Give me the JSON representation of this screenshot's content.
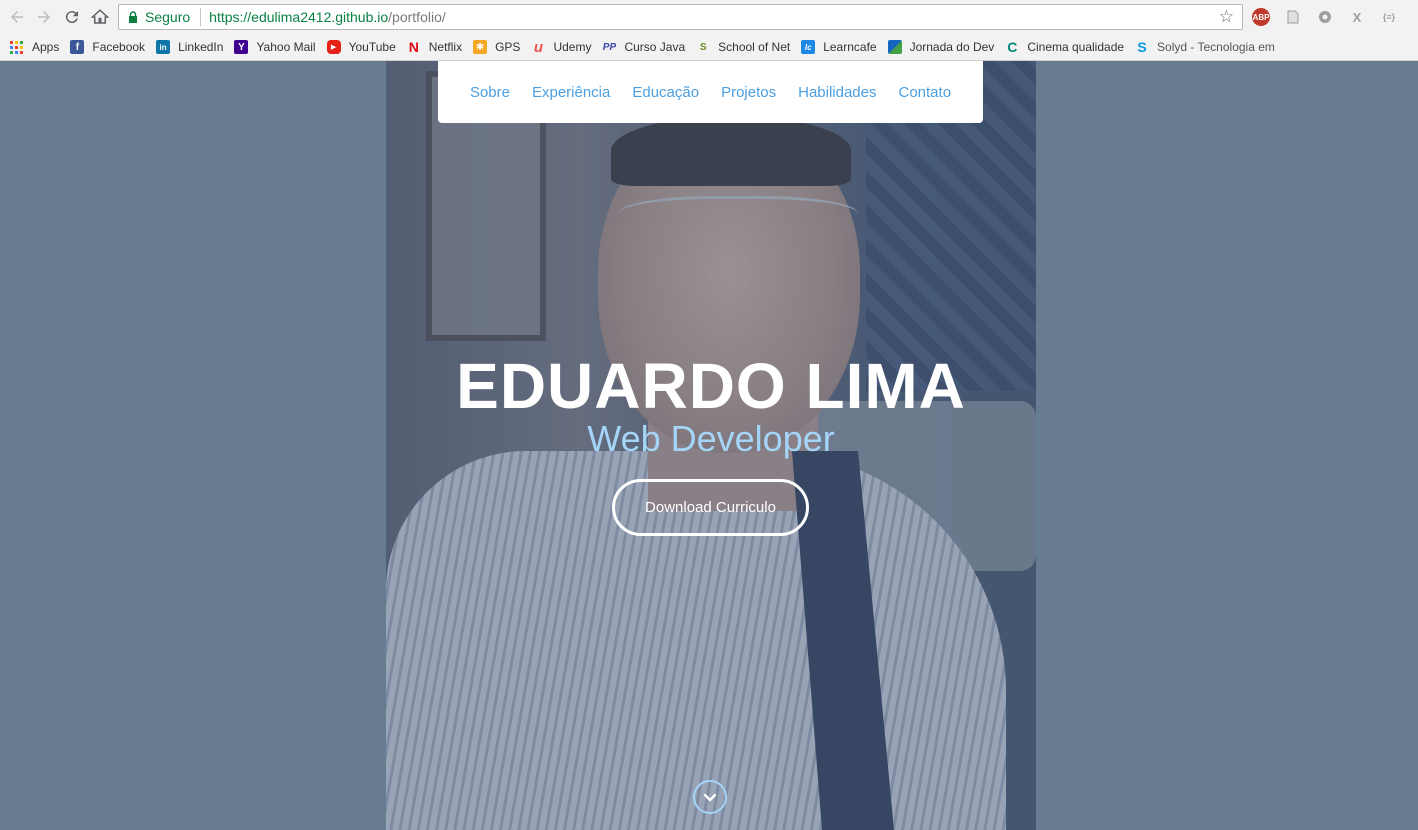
{
  "browser": {
    "secure_label": "Seguro",
    "url_host": "https://edulima2412.github.io",
    "url_path": "/portfolio/",
    "extensions": [
      {
        "name": "adblock-icon",
        "label": "ABP",
        "color": "#c0392b"
      },
      {
        "name": "pdf-extension-icon",
        "label": "",
        "color": "#9e9e9e"
      },
      {
        "name": "settings-extension-icon",
        "label": "",
        "color": "#757575"
      },
      {
        "name": "x-extension-icon",
        "label": "X",
        "color": "#9e9e9e"
      },
      {
        "name": "json-extension-icon",
        "label": "{≡}",
        "color": "#9e9e9e"
      }
    ]
  },
  "bookmarks": [
    {
      "label": "Apps",
      "icon": "apps-grid-icon"
    },
    {
      "label": "Facebook",
      "icon": "facebook-icon",
      "color": "#3b5998",
      "glyph": "f"
    },
    {
      "label": "LinkedIn",
      "icon": "linkedin-icon",
      "color": "#0e76a8",
      "glyph": "in"
    },
    {
      "label": "Yahoo Mail",
      "icon": "yahoo-icon",
      "color": "#400191",
      "glyph": "Y"
    },
    {
      "label": "YouTube",
      "icon": "youtube-icon",
      "color": "#e62117",
      "glyph": "▶"
    },
    {
      "label": "Netflix",
      "icon": "netflix-icon",
      "color": "#e50914",
      "glyph": "N"
    },
    {
      "label": "GPS",
      "icon": "gps-icon",
      "color": "#f5a623",
      "glyph": "✱"
    },
    {
      "label": "Udemy",
      "icon": "udemy-icon",
      "color": "#ec5252",
      "glyph": "u"
    },
    {
      "label": "Curso Java",
      "icon": "curso-java-icon",
      "color": "#3949ab",
      "glyph": "PP"
    },
    {
      "label": "School of Net",
      "icon": "school-of-net-icon",
      "color": "#6b8e23",
      "glyph": "S"
    },
    {
      "label": "Learncafe",
      "icon": "learncafe-icon",
      "color": "#1e88e5",
      "glyph": "lc"
    },
    {
      "label": "Jornada do Dev",
      "icon": "jornada-icon",
      "color": "#43a047",
      "glyph": "▮"
    },
    {
      "label": "Cinema qualidade",
      "icon": "cinema-icon",
      "color": "#00897b",
      "glyph": "C"
    },
    {
      "label": "Solyd - Tecnologia em",
      "icon": "solyd-icon",
      "color": "#039be5",
      "glyph": "S"
    }
  ],
  "nav": {
    "items": [
      "Sobre",
      "Experiência",
      "Educação",
      "Projetos",
      "Habilidades",
      "Contato"
    ]
  },
  "hero": {
    "name": "EDUARDO LIMA",
    "role": "Web Developer",
    "cta_label": "Download Curriculo"
  },
  "colors": {
    "page_bg": "#677b91",
    "nav_link": "#4b9fe0",
    "role_text": "#a4d4f7",
    "secure_green": "#0b8043"
  }
}
